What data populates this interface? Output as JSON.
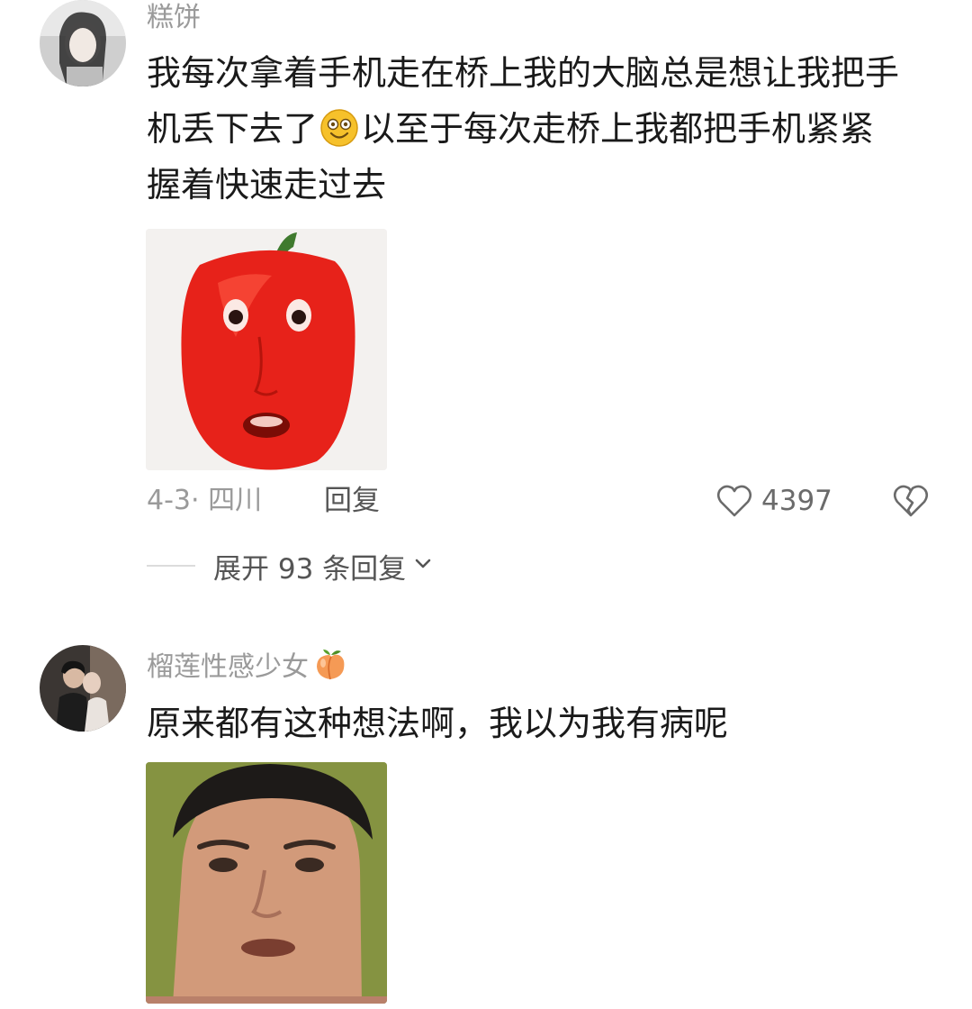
{
  "comments": [
    {
      "username": "糕饼",
      "text_lines": [
        "我每次拿着手机走在桥上我的大脑总是想让我把手",
        "机丢下去了",
        "以至于每次走桥上我都把手机紧紧",
        "握着快速走过去"
      ],
      "inline_emoji": "dizzy-smile-emoji",
      "sticker": "red-bell-pepper-face-sticker",
      "date_location": "4-3· 四川",
      "reply_label": "回复",
      "like_count": "4397",
      "expand_label": "展开 93 条回复"
    },
    {
      "username": "榴莲性感少女",
      "name_emoji": "peach-emoji",
      "text": "原来都有这种想法啊，我以为我有病呢",
      "sticker": "surprised-man-face-sticker"
    }
  ],
  "colors": {
    "username": "#9a9a9a",
    "text": "#1a1a1a",
    "meta": "#9a9a9a",
    "action": "#555555"
  }
}
